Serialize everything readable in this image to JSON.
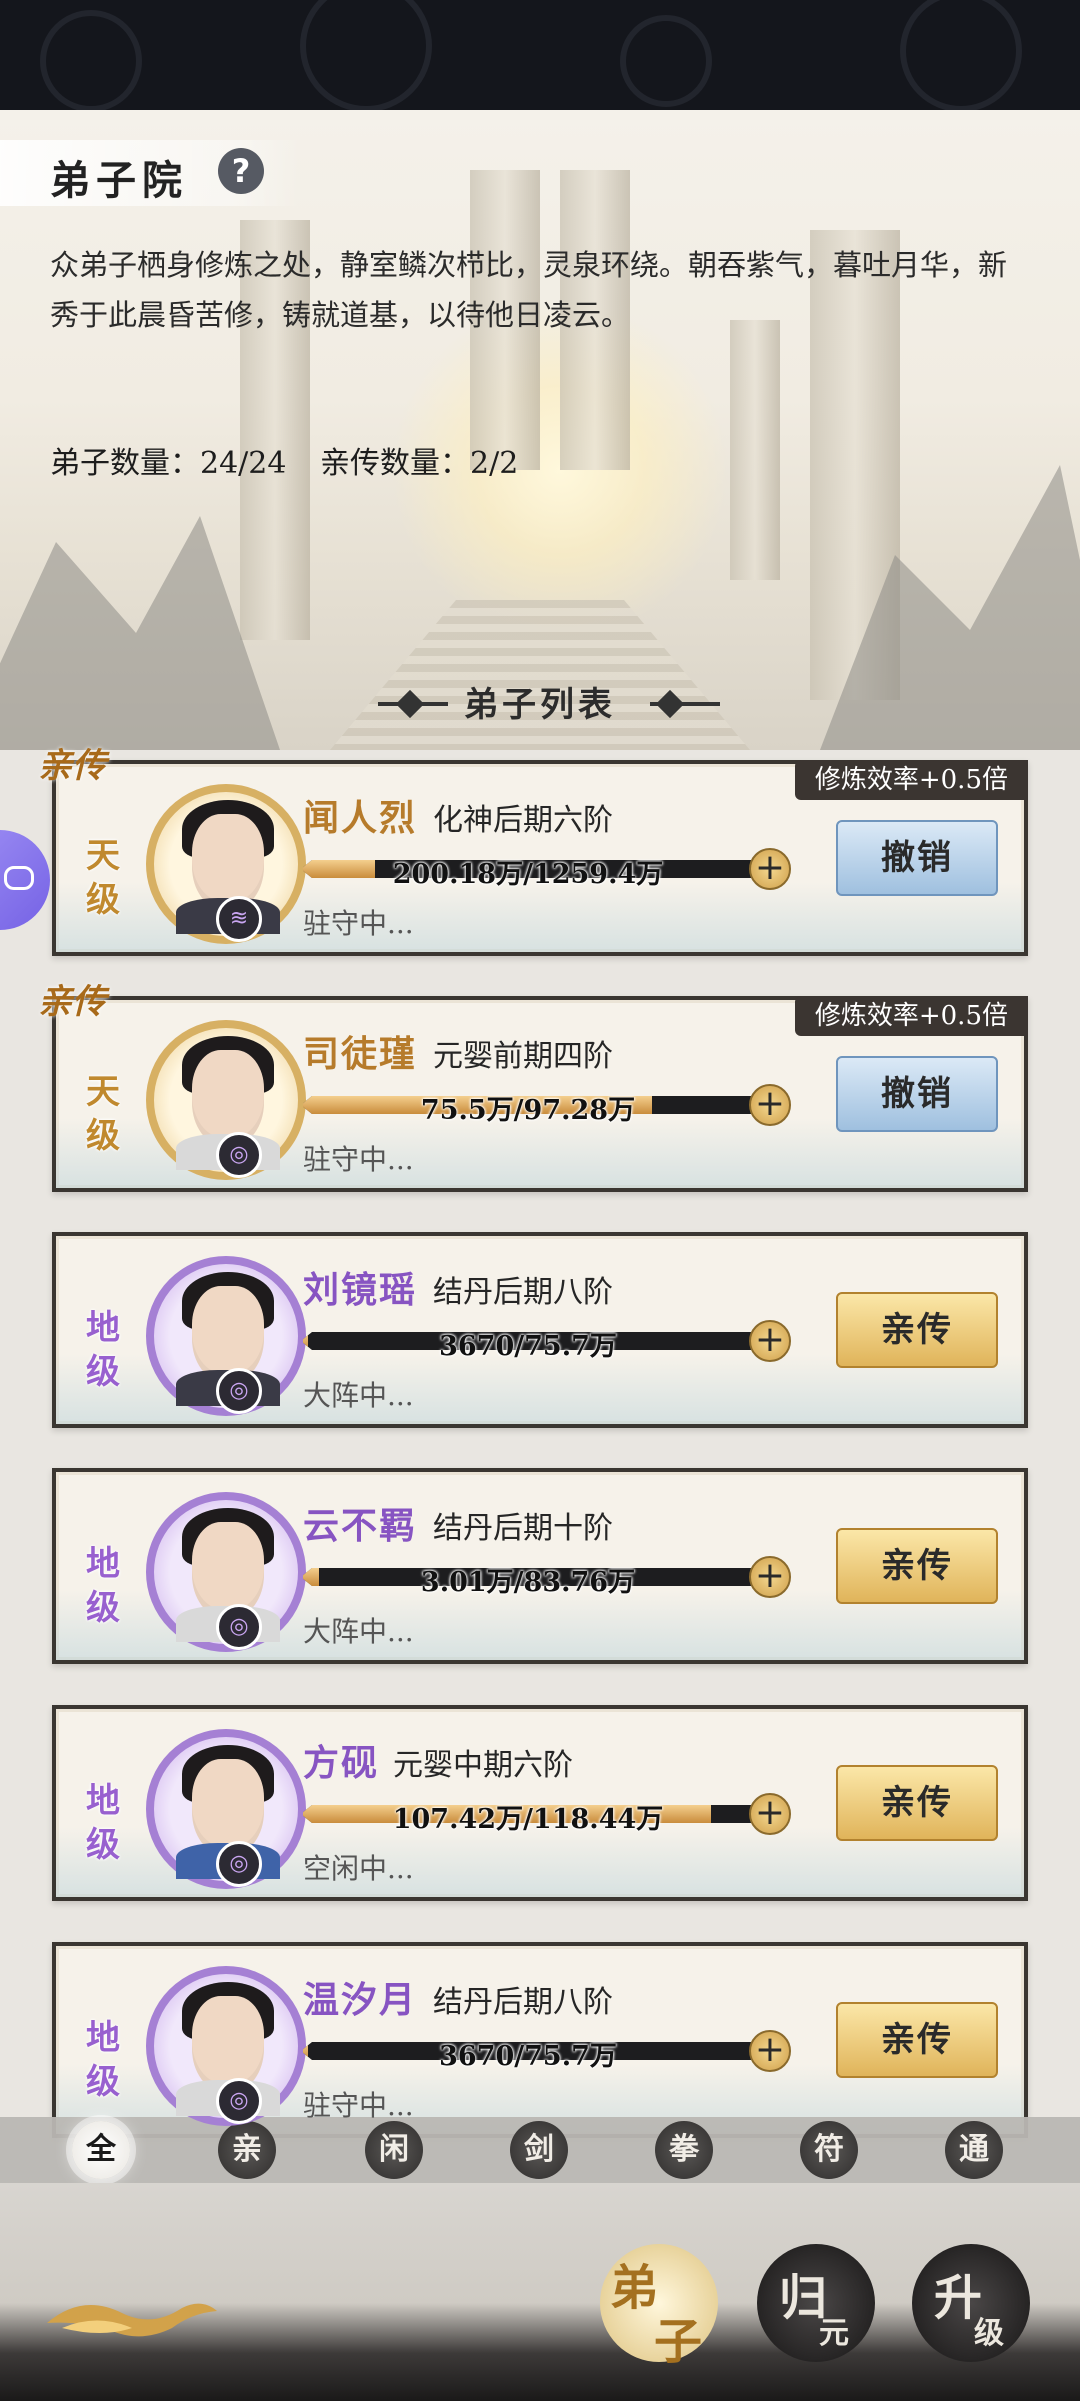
{
  "header": {
    "title": "弟子院",
    "help_label": "?",
    "description": "众弟子栖身修炼之处，静室鳞次栉比，灵泉环绕。朝吞紫气，暮吐月华，新秀于此晨昏苦修，铸就道基，以待他日凌云。",
    "disciple_count": "弟子数量：24/24",
    "direct_count": "亲传数量：2/2"
  },
  "list_title": "弟子列表",
  "disciples": [
    {
      "name": "闻人烈",
      "realm": "化神后期六阶",
      "progress_text": "200.18万/1259.4万",
      "progress": 0.159,
      "status": "驻守中...",
      "grade": "天级",
      "tier": "gold",
      "direct_tag": "亲传",
      "bonus": "修炼效率+0.5倍",
      "action": "撤销",
      "action_style": "blue",
      "element_icon": "wind-icon",
      "robe": "dark"
    },
    {
      "name": "司徒瑾",
      "realm": "元婴前期四阶",
      "progress_text": "75.5万/97.28万",
      "progress": 0.776,
      "status": "驻守中...",
      "grade": "天级",
      "tier": "gold",
      "direct_tag": "亲传",
      "bonus": "修炼效率+0.5倍",
      "action": "撤销",
      "action_style": "blue",
      "element_icon": "flame-icon",
      "robe": "white"
    },
    {
      "name": "刘镜瑶",
      "realm": "结丹后期八阶",
      "progress_text": "3670/75.7万",
      "progress": 0.005,
      "status": "大阵中...",
      "grade": "地级",
      "tier": "purple",
      "direct_tag": "",
      "bonus": "",
      "action": "亲传",
      "action_style": "gold",
      "element_icon": "flame-icon",
      "robe": "dark"
    },
    {
      "name": "云不羁",
      "realm": "结丹后期十阶",
      "progress_text": "3.01万/83.76万",
      "progress": 0.036,
      "status": "大阵中...",
      "grade": "地级",
      "tier": "purple",
      "direct_tag": "",
      "bonus": "",
      "action": "亲传",
      "action_style": "gold",
      "element_icon": "flame-icon",
      "robe": "white"
    },
    {
      "name": "方砚",
      "realm": "元婴中期六阶",
      "progress_text": "107.42万/118.44万",
      "progress": 0.907,
      "status": "空闲中...",
      "grade": "地级",
      "tier": "purple",
      "direct_tag": "",
      "bonus": "",
      "action": "亲传",
      "action_style": "gold",
      "element_icon": "flame-icon",
      "robe": "blue"
    },
    {
      "name": "温汐月",
      "realm": "结丹后期八阶",
      "progress_text": "3670/75.7万",
      "progress": 0.005,
      "status": "驻守中...",
      "grade": "地级",
      "tier": "purple",
      "direct_tag": "",
      "bonus": "",
      "action": "亲传",
      "action_style": "gold",
      "element_icon": "flame-icon",
      "robe": "white"
    }
  ],
  "filters": [
    {
      "label": "全",
      "active": true
    },
    {
      "label": "亲",
      "active": false
    },
    {
      "label": "闲",
      "active": false
    },
    {
      "label": "剑",
      "active": false
    },
    {
      "label": "拳",
      "active": false
    },
    {
      "label": "符",
      "active": false
    },
    {
      "label": "通",
      "active": false
    }
  ],
  "bottom_nav": [
    {
      "big": "弟",
      "small": "子",
      "active": true
    },
    {
      "big": "归",
      "small": "元",
      "active": false
    },
    {
      "big": "升",
      "small": "级",
      "active": false
    }
  ]
}
